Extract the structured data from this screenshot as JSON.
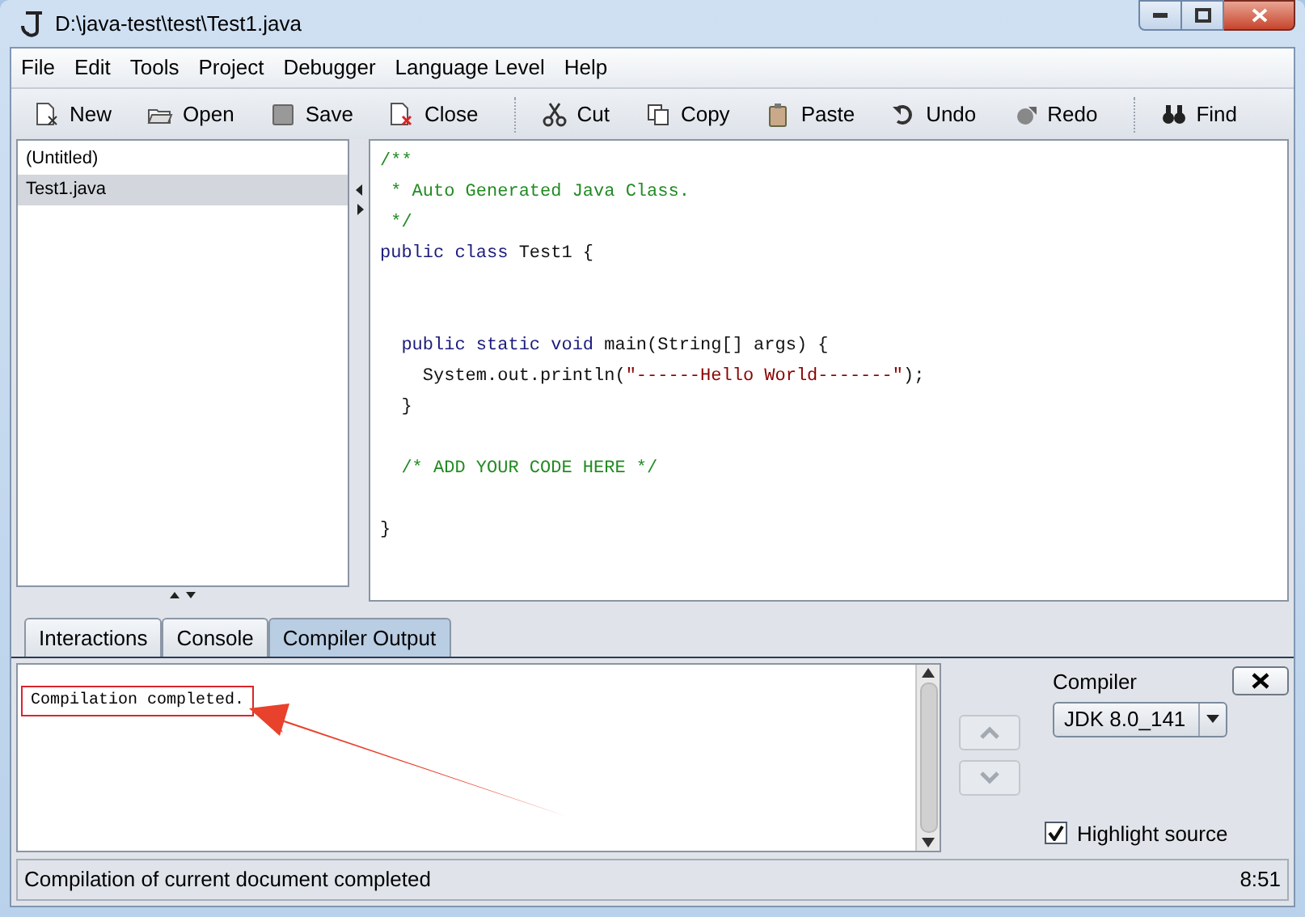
{
  "window": {
    "title": "D:\\java-test\\test\\Test1.java"
  },
  "menu": [
    "File",
    "Edit",
    "Tools",
    "Project",
    "Debugger",
    "Language Level",
    "Help"
  ],
  "toolbar": [
    {
      "label": "New",
      "group_start": false
    },
    {
      "label": "Open",
      "group_start": false
    },
    {
      "label": "Save",
      "group_start": false
    },
    {
      "label": "Close",
      "group_start": false
    },
    {
      "label": "Cut",
      "group_start": true
    },
    {
      "label": "Copy",
      "group_start": false
    },
    {
      "label": "Paste",
      "group_start": false
    },
    {
      "label": "Undo",
      "group_start": false
    },
    {
      "label": "Redo",
      "group_start": false
    },
    {
      "label": "Find",
      "group_start": true
    }
  ],
  "documents": [
    {
      "name": "(Untitled)",
      "selected": false
    },
    {
      "name": "Test1.java",
      "selected": true
    }
  ],
  "editor": {
    "lines": [
      {
        "kind": "code",
        "tokens": [
          {
            "kind": "comment",
            "text": "/**"
          }
        ]
      },
      {
        "kind": "code",
        "tokens": [
          {
            "kind": "comment",
            "text": " * Auto Generated Java Class."
          }
        ]
      },
      {
        "kind": "code",
        "tokens": [
          {
            "kind": "comment",
            "text": " */"
          }
        ]
      },
      {
        "kind": "code",
        "tokens": [
          {
            "kind": "keyword",
            "text": "public class "
          },
          {
            "kind": "plain",
            "text": "Test1 {"
          }
        ]
      },
      {
        "kind": "blank"
      },
      {
        "kind": "blank"
      },
      {
        "kind": "code",
        "tokens": [
          {
            "kind": "keyword",
            "text": "  public static void "
          },
          {
            "kind": "plain",
            "text": "main(String[] args) {"
          }
        ]
      },
      {
        "kind": "code",
        "tokens": [
          {
            "kind": "plain",
            "text": "    System.out.println("
          },
          {
            "kind": "string",
            "text": "\"------Hello World-------\""
          },
          {
            "kind": "plain",
            "text": ");"
          }
        ]
      },
      {
        "kind": "code",
        "tokens": [
          {
            "kind": "plain",
            "text": "  }"
          }
        ]
      },
      {
        "kind": "blank"
      },
      {
        "kind": "code",
        "tokens": [
          {
            "kind": "comment",
            "text": "  /* ADD YOUR CODE HERE */"
          }
        ]
      },
      {
        "kind": "blank"
      },
      {
        "kind": "code",
        "tokens": [
          {
            "kind": "plain",
            "text": "}"
          }
        ]
      }
    ]
  },
  "tabs": [
    {
      "label": "Interactions",
      "selected": false
    },
    {
      "label": "Console",
      "selected": false
    },
    {
      "label": "Compiler Output",
      "selected": true
    }
  ],
  "output": {
    "text": "Compilation completed.",
    "highlighted": true
  },
  "compiler": {
    "label": "Compiler",
    "value": "JDK 8.0_141",
    "highlight_source": {
      "label": "Highlight source",
      "checked": true
    }
  },
  "status_bar": {
    "message": "Compilation of current document completed",
    "time": "8:51"
  }
}
